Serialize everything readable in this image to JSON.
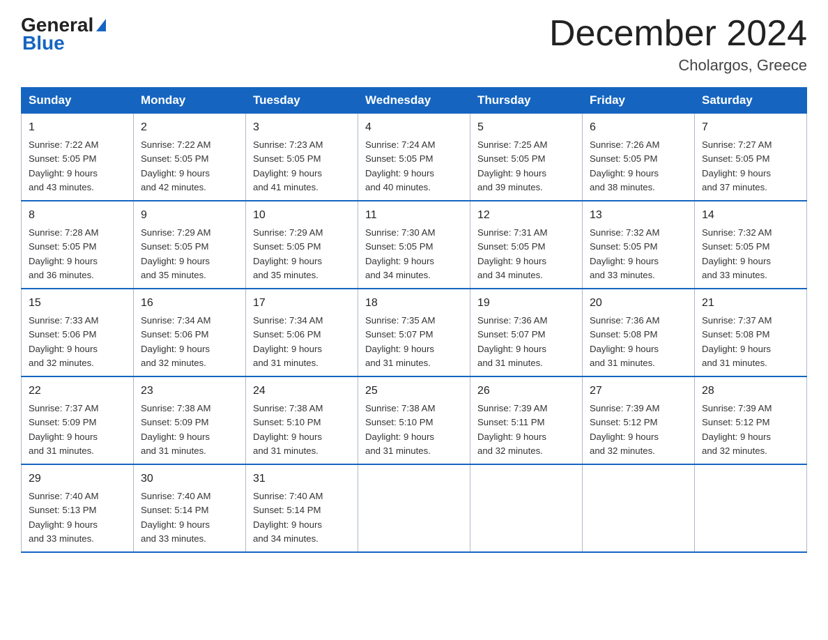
{
  "logo": {
    "general": "General",
    "blue": "Blue"
  },
  "title": "December 2024",
  "location": "Cholargos, Greece",
  "days_of_week": [
    "Sunday",
    "Monday",
    "Tuesday",
    "Wednesday",
    "Thursday",
    "Friday",
    "Saturday"
  ],
  "weeks": [
    [
      {
        "day": "1",
        "sunrise": "7:22 AM",
        "sunset": "5:05 PM",
        "daylight": "9 hours and 43 minutes."
      },
      {
        "day": "2",
        "sunrise": "7:22 AM",
        "sunset": "5:05 PM",
        "daylight": "9 hours and 42 minutes."
      },
      {
        "day": "3",
        "sunrise": "7:23 AM",
        "sunset": "5:05 PM",
        "daylight": "9 hours and 41 minutes."
      },
      {
        "day": "4",
        "sunrise": "7:24 AM",
        "sunset": "5:05 PM",
        "daylight": "9 hours and 40 minutes."
      },
      {
        "day": "5",
        "sunrise": "7:25 AM",
        "sunset": "5:05 PM",
        "daylight": "9 hours and 39 minutes."
      },
      {
        "day": "6",
        "sunrise": "7:26 AM",
        "sunset": "5:05 PM",
        "daylight": "9 hours and 38 minutes."
      },
      {
        "day": "7",
        "sunrise": "7:27 AM",
        "sunset": "5:05 PM",
        "daylight": "9 hours and 37 minutes."
      }
    ],
    [
      {
        "day": "8",
        "sunrise": "7:28 AM",
        "sunset": "5:05 PM",
        "daylight": "9 hours and 36 minutes."
      },
      {
        "day": "9",
        "sunrise": "7:29 AM",
        "sunset": "5:05 PM",
        "daylight": "9 hours and 35 minutes."
      },
      {
        "day": "10",
        "sunrise": "7:29 AM",
        "sunset": "5:05 PM",
        "daylight": "9 hours and 35 minutes."
      },
      {
        "day": "11",
        "sunrise": "7:30 AM",
        "sunset": "5:05 PM",
        "daylight": "9 hours and 34 minutes."
      },
      {
        "day": "12",
        "sunrise": "7:31 AM",
        "sunset": "5:05 PM",
        "daylight": "9 hours and 34 minutes."
      },
      {
        "day": "13",
        "sunrise": "7:32 AM",
        "sunset": "5:05 PM",
        "daylight": "9 hours and 33 minutes."
      },
      {
        "day": "14",
        "sunrise": "7:32 AM",
        "sunset": "5:05 PM",
        "daylight": "9 hours and 33 minutes."
      }
    ],
    [
      {
        "day": "15",
        "sunrise": "7:33 AM",
        "sunset": "5:06 PM",
        "daylight": "9 hours and 32 minutes."
      },
      {
        "day": "16",
        "sunrise": "7:34 AM",
        "sunset": "5:06 PM",
        "daylight": "9 hours and 32 minutes."
      },
      {
        "day": "17",
        "sunrise": "7:34 AM",
        "sunset": "5:06 PM",
        "daylight": "9 hours and 31 minutes."
      },
      {
        "day": "18",
        "sunrise": "7:35 AM",
        "sunset": "5:07 PM",
        "daylight": "9 hours and 31 minutes."
      },
      {
        "day": "19",
        "sunrise": "7:36 AM",
        "sunset": "5:07 PM",
        "daylight": "9 hours and 31 minutes."
      },
      {
        "day": "20",
        "sunrise": "7:36 AM",
        "sunset": "5:08 PM",
        "daylight": "9 hours and 31 minutes."
      },
      {
        "day": "21",
        "sunrise": "7:37 AM",
        "sunset": "5:08 PM",
        "daylight": "9 hours and 31 minutes."
      }
    ],
    [
      {
        "day": "22",
        "sunrise": "7:37 AM",
        "sunset": "5:09 PM",
        "daylight": "9 hours and 31 minutes."
      },
      {
        "day": "23",
        "sunrise": "7:38 AM",
        "sunset": "5:09 PM",
        "daylight": "9 hours and 31 minutes."
      },
      {
        "day": "24",
        "sunrise": "7:38 AM",
        "sunset": "5:10 PM",
        "daylight": "9 hours and 31 minutes."
      },
      {
        "day": "25",
        "sunrise": "7:38 AM",
        "sunset": "5:10 PM",
        "daylight": "9 hours and 31 minutes."
      },
      {
        "day": "26",
        "sunrise": "7:39 AM",
        "sunset": "5:11 PM",
        "daylight": "9 hours and 32 minutes."
      },
      {
        "day": "27",
        "sunrise": "7:39 AM",
        "sunset": "5:12 PM",
        "daylight": "9 hours and 32 minutes."
      },
      {
        "day": "28",
        "sunrise": "7:39 AM",
        "sunset": "5:12 PM",
        "daylight": "9 hours and 32 minutes."
      }
    ],
    [
      {
        "day": "29",
        "sunrise": "7:40 AM",
        "sunset": "5:13 PM",
        "daylight": "9 hours and 33 minutes."
      },
      {
        "day": "30",
        "sunrise": "7:40 AM",
        "sunset": "5:14 PM",
        "daylight": "9 hours and 33 minutes."
      },
      {
        "day": "31",
        "sunrise": "7:40 AM",
        "sunset": "5:14 PM",
        "daylight": "9 hours and 34 minutes."
      },
      null,
      null,
      null,
      null
    ]
  ],
  "labels": {
    "sunrise": "Sunrise: ",
    "sunset": "Sunset: ",
    "daylight": "Daylight: "
  }
}
